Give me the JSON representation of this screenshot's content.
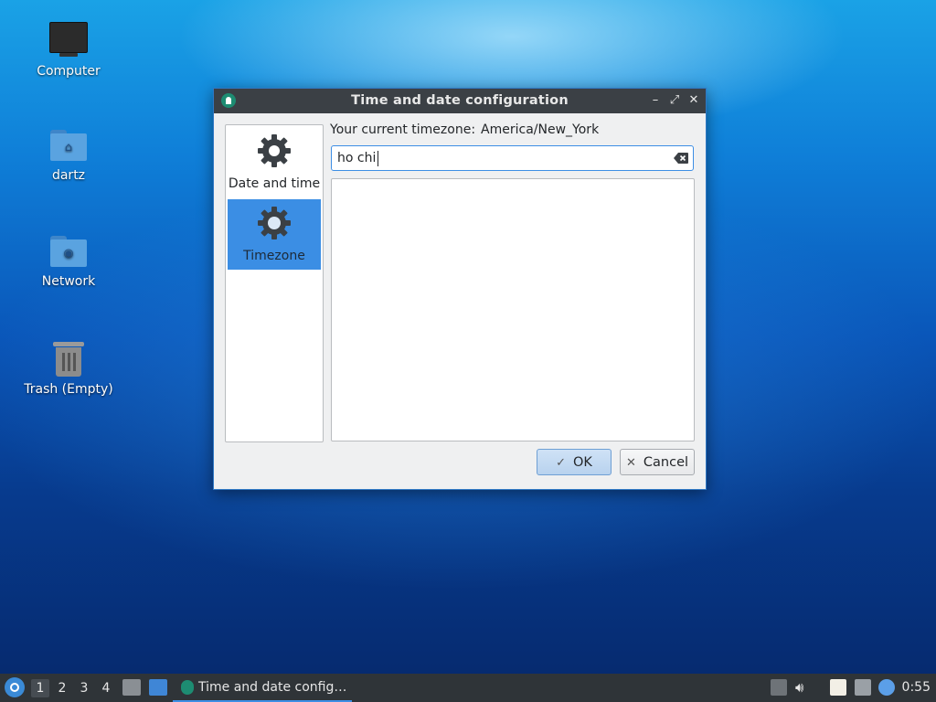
{
  "desktop": {
    "icons": [
      {
        "label": "Computer"
      },
      {
        "label": "dartz"
      },
      {
        "label": "Network"
      },
      {
        "label": "Trash (Empty)"
      }
    ]
  },
  "dialog": {
    "title": "Time and date configuration",
    "sidebar": [
      {
        "label": "Date and time",
        "icon": "gear-icon"
      },
      {
        "label": "Timezone",
        "icon": "gear-icon",
        "selected": true
      }
    ],
    "current_timezone_label": "Your current timezone:",
    "current_timezone_value": "America/New_York",
    "search_value": "ho chi ",
    "ok_label": "OK",
    "cancel_label": "Cancel"
  },
  "taskbar": {
    "workspaces": [
      "1",
      "2",
      "3",
      "4"
    ],
    "active_workspace": "1",
    "task_label": "Time and date config…",
    "clock": "0:55"
  },
  "colors": {
    "accent": "#3d8ee5",
    "selection": "#3b8ee4",
    "titlebar": "#3b4045",
    "taskbar": "#2f3438"
  }
}
